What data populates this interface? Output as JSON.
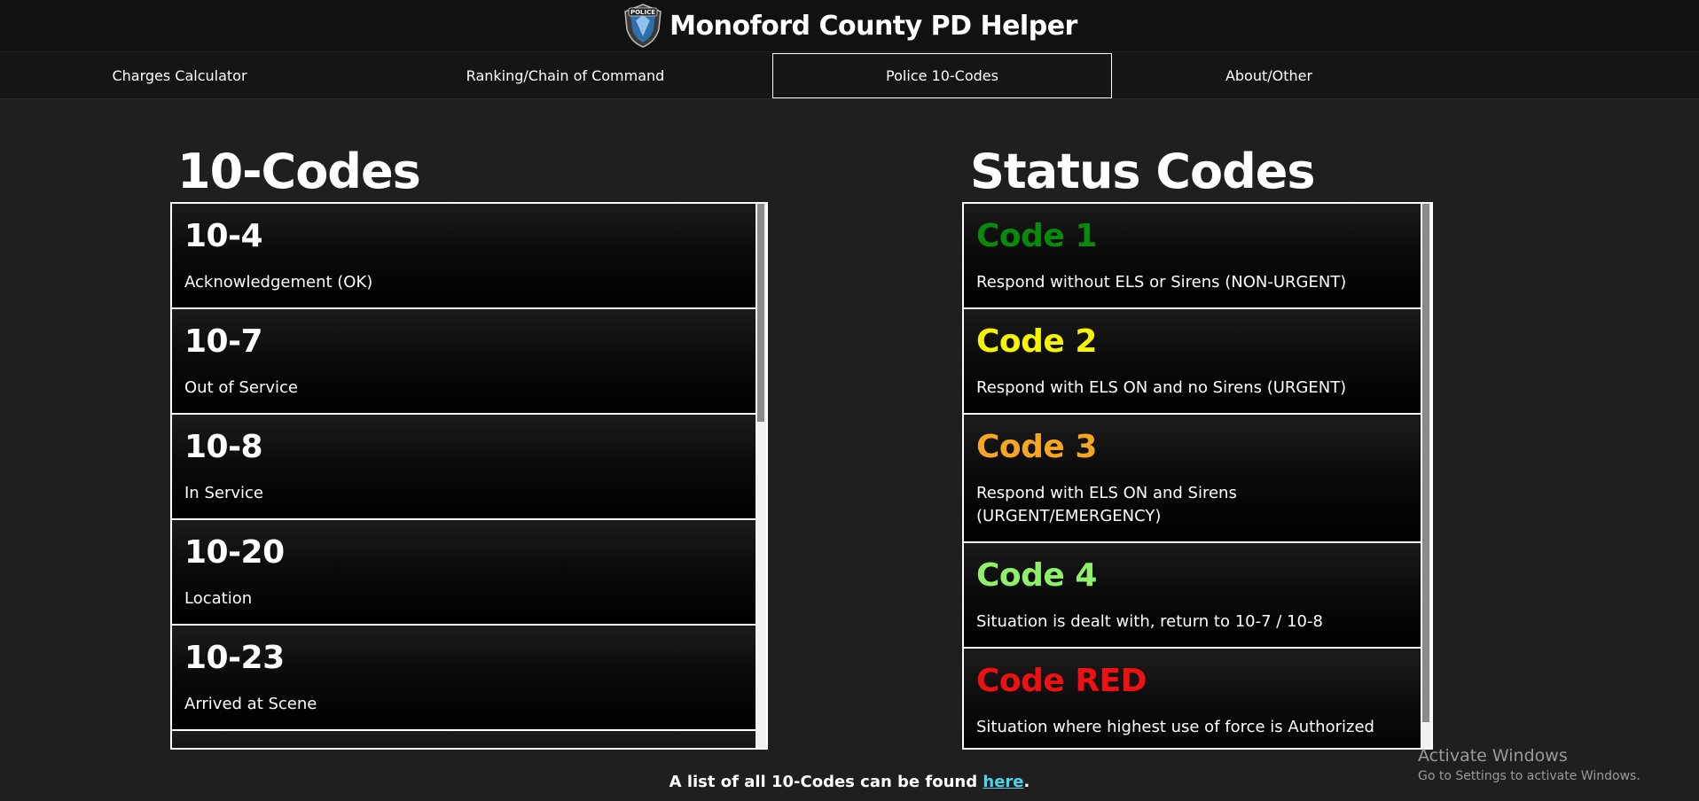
{
  "header": {
    "title": "Monoford County PD Helper",
    "logo_icon": "police-badge-icon",
    "logo_text": "POLICE"
  },
  "nav": {
    "items": [
      {
        "label": "Charges Calculator",
        "active": false
      },
      {
        "label": "Ranking/Chain of Command",
        "active": false
      },
      {
        "label": "Police 10-Codes",
        "active": true
      },
      {
        "label": "About/Other",
        "active": false
      }
    ]
  },
  "ten_codes": {
    "title": "10-Codes",
    "items": [
      {
        "code": "10-4",
        "desc": "Acknowledgement (OK)"
      },
      {
        "code": "10-7",
        "desc": "Out of Service"
      },
      {
        "code": "10-8",
        "desc": "In Service"
      },
      {
        "code": "10-20",
        "desc": "Location"
      },
      {
        "code": "10-23",
        "desc": "Arrived at Scene"
      },
      {
        "code": "",
        "desc": ""
      }
    ]
  },
  "status_codes": {
    "title": "Status Codes",
    "items": [
      {
        "code": "Code 1",
        "desc": "Respond without ELS or Sirens (NON-URGENT)",
        "color": "#0a8a0a"
      },
      {
        "code": "Code 2",
        "desc": "Respond with ELS ON and no Sirens (URGENT)",
        "color": "#f5f500"
      },
      {
        "code": "Code 3",
        "desc": "Respond with ELS ON and Sirens (URGENT/EMERGENCY)",
        "color": "#f5a623"
      },
      {
        "code": "Code 4",
        "desc": "Situation is dealt with, return to 10-7 / 10-8",
        "color": "#8ff06a"
      },
      {
        "code": "Code RED",
        "desc": "Situation where highest use of force is Authorized",
        "color": "#ee1111"
      }
    ]
  },
  "footer": {
    "text": "A list of all 10-Codes can be found ",
    "link_label": "here",
    "suffix": "."
  },
  "watermark": {
    "line1": "Activate Windows",
    "line2": "Go to Settings to activate Windows."
  }
}
